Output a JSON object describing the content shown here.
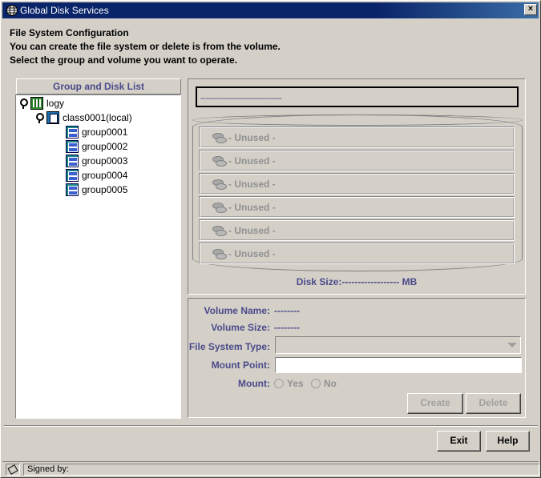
{
  "window": {
    "title": "Global Disk Services",
    "close_glyph": "×"
  },
  "header": {
    "title": "File System Configuration",
    "line1": "You can create the file system or delete is from the volume.",
    "line2": "Select the group and volume you want to operate."
  },
  "tree": {
    "header": "Group and Disk List",
    "root": "logy",
    "class": "class0001(local)",
    "groups": [
      "group0001",
      "group0002",
      "group0003",
      "group0004",
      "group0005"
    ]
  },
  "volume_panel": {
    "name_placeholder": "--------------------------------",
    "slices": [
      "- Unused -",
      "- Unused -",
      "- Unused -",
      "- Unused -",
      "- Unused -",
      "- Unused -"
    ],
    "disk_size": "Disk Size:------------------ MB"
  },
  "form": {
    "volume_name_label": "Volume Name:",
    "volume_name_value": "--------",
    "volume_size_label": "Volume Size:",
    "volume_size_value": "--------",
    "fs_type_label": "File System Type:",
    "fs_type_value": "",
    "mount_point_label": "Mount Point:",
    "mount_point_value": "",
    "mount_label": "Mount:",
    "mount_yes": "Yes",
    "mount_no": "No",
    "create_label": "Create",
    "delete_label": "Delete"
  },
  "footer": {
    "exit_label": "Exit",
    "help_label": "Help"
  },
  "status": {
    "text": "Signed by:"
  },
  "icons": {
    "app": "globe-icon",
    "pin": "pin-icon",
    "root": "server-icon",
    "class": "class-icon",
    "group": "disk-group-icon",
    "slice": "disk-icon",
    "status": "signature-icon"
  }
}
